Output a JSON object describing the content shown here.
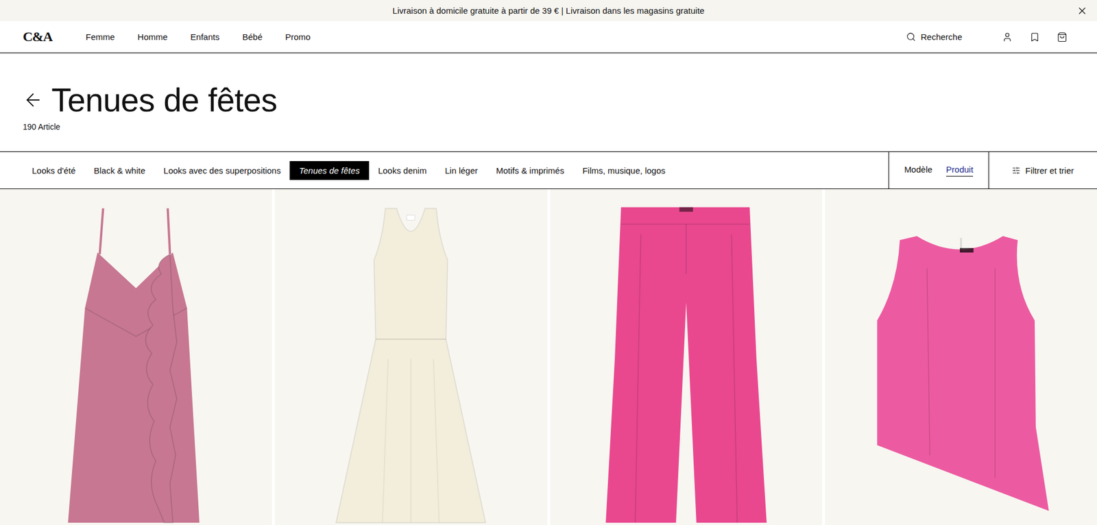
{
  "banner": {
    "text": "Livraison à domicile gratuite à partir de 39 € | Livraison dans les magasins gratuite"
  },
  "header": {
    "logo": "C&A",
    "nav": [
      {
        "label": "Femme"
      },
      {
        "label": "Homme"
      },
      {
        "label": "Enfants"
      },
      {
        "label": "Bébé"
      },
      {
        "label": "Promo"
      }
    ],
    "search": "Recherche"
  },
  "page": {
    "title": "Tenues de fêtes",
    "count": "190 Article"
  },
  "categories": [
    {
      "label": "Looks d'été",
      "selected": false
    },
    {
      "label": "Black & white",
      "selected": false
    },
    {
      "label": "Looks avec des superpositions",
      "selected": false
    },
    {
      "label": "Tenues de fêtes",
      "selected": true
    },
    {
      "label": "Looks denim",
      "selected": false
    },
    {
      "label": "Lin léger",
      "selected": false
    },
    {
      "label": "Motifs & imprimés",
      "selected": false
    },
    {
      "label": "Films, musique, logos",
      "selected": false
    }
  ],
  "view_toggle": [
    {
      "label": "Modèle",
      "selected": false
    },
    {
      "label": "Produit",
      "selected": true
    }
  ],
  "filter": {
    "label": "Filtrer et trier"
  },
  "products": [
    {
      "kind": "ruffle-dress",
      "color": "#c77792"
    },
    {
      "kind": "tank-dress",
      "color": "#f3eddc"
    },
    {
      "kind": "trousers",
      "color": "#e9488f"
    },
    {
      "kind": "top",
      "color": "#ec5ba1"
    }
  ]
}
